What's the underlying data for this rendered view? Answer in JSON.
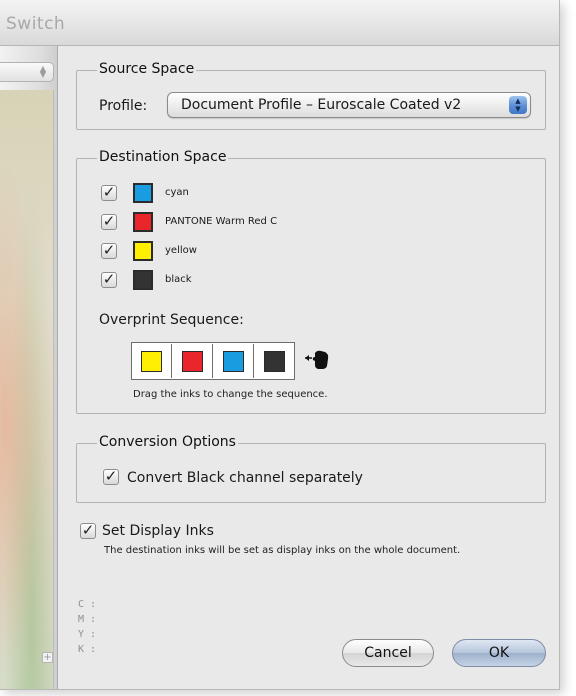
{
  "window": {
    "title": "Switch"
  },
  "source_space": {
    "legend": "Source Space",
    "profile_label": "Profile:",
    "profile_value": "Document Profile – Euroscale Coated v2"
  },
  "destination_space": {
    "legend": "Destination Space",
    "inks": [
      {
        "name": "cyan",
        "checked": true,
        "color": "#1a9ce0"
      },
      {
        "name": "PANTONE Warm Red C",
        "checked": true,
        "color": "#e8262c"
      },
      {
        "name": "yellow",
        "checked": true,
        "color": "#ffef00"
      },
      {
        "name": "black",
        "checked": true,
        "color": "#333333"
      }
    ],
    "overprint_label": "Overprint Sequence:",
    "sequence": [
      {
        "color": "#ffef00"
      },
      {
        "color": "#e8262c"
      },
      {
        "color": "#1a9ce0"
      },
      {
        "color": "#333333"
      }
    ],
    "drag_hint": "Drag the inks to change the sequence."
  },
  "conversion_options": {
    "legend": "Conversion Options",
    "convert_black_label": "Convert Black channel separately",
    "convert_black_checked": true
  },
  "display_inks": {
    "label": "Set Display Inks",
    "checked": true,
    "note": "The destination inks will be set as display inks on the whole document."
  },
  "info": {
    "c": "C :",
    "m": "M :",
    "y": "Y :",
    "k": "K :"
  },
  "buttons": {
    "cancel": "Cancel",
    "ok": "OK"
  },
  "icons": {
    "check": "✓",
    "hand": "hand-pointer-icon",
    "popup": "updown-arrows-icon"
  }
}
